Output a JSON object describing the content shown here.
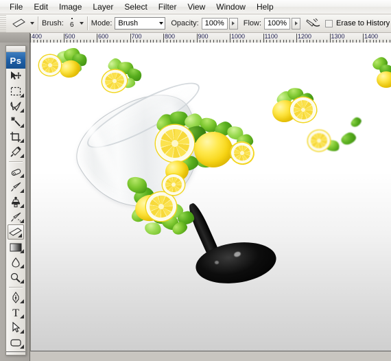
{
  "app": {
    "name": "Adobe Photoshop",
    "logo_text": "Ps"
  },
  "menubar": {
    "items": [
      {
        "label": "File"
      },
      {
        "label": "Edit"
      },
      {
        "label": "Image"
      },
      {
        "label": "Layer"
      },
      {
        "label": "Select"
      },
      {
        "label": "Filter"
      },
      {
        "label": "View"
      },
      {
        "label": "Window"
      },
      {
        "label": "Help"
      }
    ]
  },
  "options_bar": {
    "tool_icon": "eraser-icon",
    "brush_label": "Brush:",
    "brush_size": "6",
    "mode_label": "Mode:",
    "mode_value": "Brush",
    "opacity_label": "Opacity:",
    "opacity_value": "100%",
    "flow_label": "Flow:",
    "flow_value": "100%",
    "airbrush_icon": "airbrush-icon",
    "erase_to_history_label": "Erase to History",
    "erase_to_history_checked": false
  },
  "ruler": {
    "unit": "pixels",
    "labels": [
      "400",
      "500",
      "600",
      "700",
      "800",
      "900",
      "1000",
      "1100",
      "1200",
      "1300",
      "1400"
    ],
    "start_value": 400,
    "end_value": 1400,
    "step": 100
  },
  "toolbox": {
    "selected_tool": "eraser-tool",
    "tools": [
      {
        "name": "move-tool",
        "has_flyout": false
      },
      {
        "name": "rectangular-marquee-tool",
        "has_flyout": true
      },
      {
        "name": "lasso-tool",
        "has_flyout": true
      },
      {
        "name": "magic-wand-tool",
        "has_flyout": true
      },
      {
        "name": "crop-tool",
        "has_flyout": true
      },
      {
        "name": "eyedropper-tool",
        "has_flyout": true
      },
      {
        "name": "healing-brush-tool",
        "has_flyout": true
      },
      {
        "name": "brush-tool",
        "has_flyout": true
      },
      {
        "name": "clone-stamp-tool",
        "has_flyout": true
      },
      {
        "name": "history-brush-tool",
        "has_flyout": true
      },
      {
        "name": "eraser-tool",
        "has_flyout": true
      },
      {
        "name": "gradient-tool",
        "has_flyout": true
      },
      {
        "name": "blur-tool",
        "has_flyout": true
      },
      {
        "name": "dodge-tool",
        "has_flyout": true
      },
      {
        "name": "pen-tool",
        "has_flyout": true
      },
      {
        "name": "type-tool",
        "has_flyout": true
      },
      {
        "name": "path-selection-tool",
        "has_flyout": true
      },
      {
        "name": "rounded-rectangle-tool",
        "has_flyout": true
      }
    ]
  },
  "canvas": {
    "artwork_description": "Tilted wine glass with black stem surrounded by lemons and mint leaves on white-to-gray gradient background"
  },
  "colors": {
    "accent": "#1f5fa6",
    "lemon_yellow": "#f7d411",
    "leaf_green": "#7dc72f",
    "chrome": "#e7e5e0",
    "ruler_label": "#1b1b4f"
  }
}
